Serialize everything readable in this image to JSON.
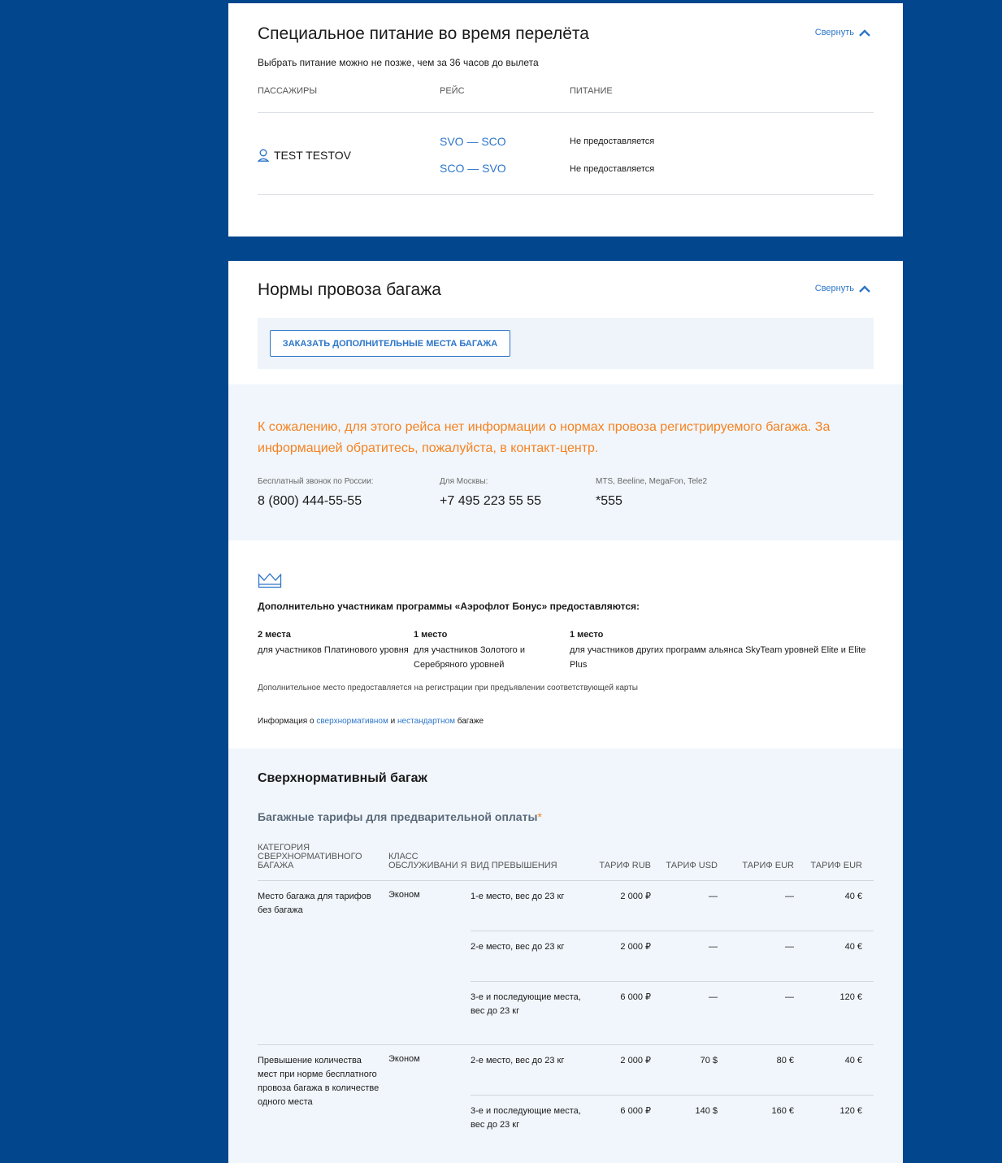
{
  "meals": {
    "title": "Специальное питание во время перелёта",
    "collapse_label": "Свернуть",
    "subtitle": "Выбрать питание можно не позже, чем за 36 часов до вылета",
    "columns": [
      "Пассажиры",
      "Рейс",
      "Питание"
    ],
    "passenger": "TEST TESTOV",
    "flights": [
      {
        "route": "SVO — SCO",
        "meal": "Не предоставляется"
      },
      {
        "route": "SCO — SVO",
        "meal": "Не предоставляется"
      }
    ]
  },
  "baggage": {
    "title": "Нормы провоза багажа",
    "collapse_label": "Свернуть",
    "order_button": "ЗАКАЗАТЬ ДОПОЛНИТЕЛЬНЫЕ МЕСТА БАГАЖА",
    "warning": "К сожалению, для этого рейса нет информации о нормах провоза регистрируемого багажа. За информацией обратитесь, пожалуйста, в контакт-центр.",
    "contacts": [
      {
        "label": "Бесплатный звонок по России:",
        "number": "8 (800) 444-55-55"
      },
      {
        "label": "Для Москвы:",
        "number": "+7 495 223 55 55"
      },
      {
        "label": "MTS, Beeline, MegaFon, Tele2",
        "number": "*555"
      }
    ],
    "bonus": {
      "title": "Дополнительно участникам программы «Аэрофлот Бонус» предоставляются:",
      "items": [
        {
          "count": "2 места",
          "desc": "для участников Платинового уровня"
        },
        {
          "count": "1 место",
          "desc": "для участников Золотого и Серебряного уровней"
        },
        {
          "count": "1 место",
          "desc": "для участников других программ альянса SkyTeam уровней Elite и Elite Plus"
        }
      ],
      "note": "Дополнительное место предоставляется на регистрации при предъявлении соответствующей карты",
      "info_prefix": "Информация о",
      "info_link1": "сверхнормативном",
      "info_mid": "и",
      "info_link2": "нестандартном",
      "info_suffix": "багаже"
    },
    "excess": {
      "title": "Сверхнормативный багаж",
      "tariff_title": "Багажные тарифы для предварительной оплаты",
      "tariff_star": "*",
      "headers": [
        "Категория сверхнормативного багажа",
        "Класс обслуживани я",
        "Вид превышения",
        "Тариф RUB",
        "Тариф USD",
        "Тариф EUR",
        "Тариф EUR"
      ],
      "groups": [
        {
          "category": "Место багажа для тарифов без багажа",
          "class": "Эконом",
          "rows": [
            {
              "type": "1-е место, вес до 23 кг",
              "rub": "2 000 ₽",
              "usd": "—",
              "eur": "—",
              "eur2": "40 €"
            },
            {
              "type": "2-е место, вес до 23 кг",
              "rub": "2 000 ₽",
              "usd": "—",
              "eur": "—",
              "eur2": "40 €"
            },
            {
              "type": "3-е и последующие места, вес до 23 кг",
              "rub": "6 000 ₽",
              "usd": "—",
              "eur": "—",
              "eur2": "120 €"
            }
          ]
        },
        {
          "category": "Превышение количества мест при норме бесплатного провоза багажа в количестве одного места",
          "class": "Эконом",
          "rows": [
            {
              "type": "2-е место, вес до 23 кг",
              "rub": "2 000 ₽",
              "usd": "70 $",
              "eur": "80 €",
              "eur2": "40 €"
            },
            {
              "type": "3-е и последующие места, вес до 23 кг",
              "rub": "6 000 ₽",
              "usd": "140 $",
              "eur": "160 €",
              "eur2": "120 €"
            }
          ]
        }
      ]
    }
  },
  "colors": {
    "background": "#02468d",
    "accent": "#2d76c9",
    "warning": "#f58220"
  },
  "icons": [
    "chevron-up-icon",
    "person-icon",
    "crown-icon"
  ]
}
